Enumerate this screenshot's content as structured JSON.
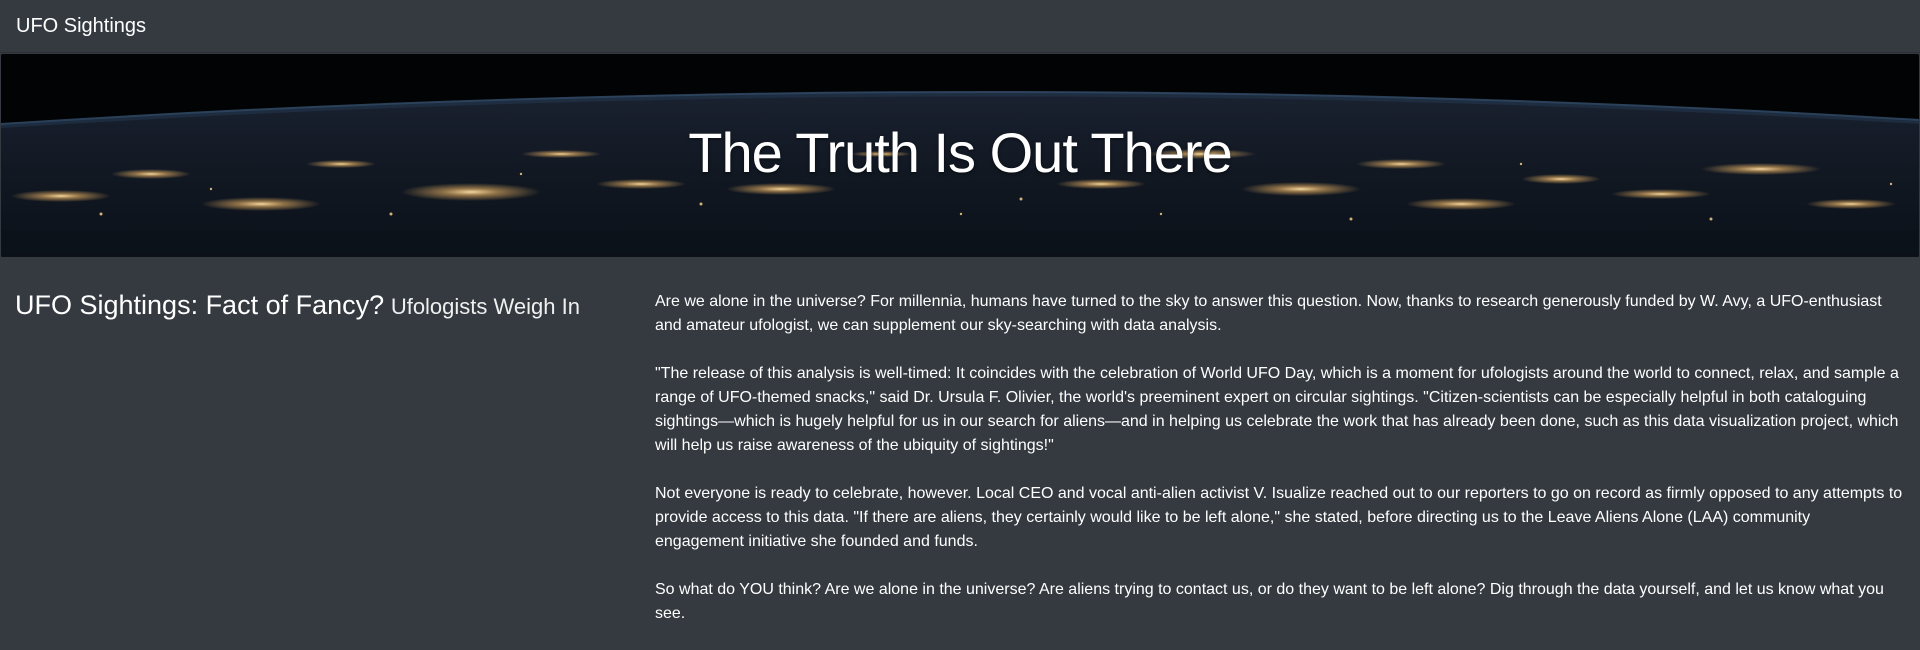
{
  "navbar": {
    "brand": "UFO Sightings"
  },
  "hero": {
    "title": "The Truth Is Out There"
  },
  "headline": {
    "main": "UFO Sightings: Fact of Fancy?",
    "sub": "Ufologists Weigh In"
  },
  "article": {
    "paragraphs": [
      "Are we alone in the universe? For millennia, humans have turned to the sky to answer this question. Now, thanks to research generously funded by W. Avy, a UFO-enthusiast and amateur ufologist, we can supplement our sky-searching with data analysis.",
      "\"The release of this analysis is well-timed: It coincides with the celebration of World UFO Day, which is a moment for ufologists around the world to connect, relax, and sample a range of UFO-themed snacks,\" said Dr. Ursula F. Olivier, the world's preeminent expert on circular sightings. \"Citizen-scientists can be especially helpful in both cataloguing sightings—which is hugely helpful for us in our search for aliens—and in helping us celebrate the work that has already been done, such as this data visualization project, which will help us raise awareness of the ubiquity of sightings!\"",
      "Not everyone is ready to celebrate, however. Local CEO and vocal anti-alien activist V. Isualize reached out to our reporters to go on record as firmly opposed to any attempts to provide access to this data. \"If there are aliens, they certainly would like to be left alone,\" she stated, before directing us to the Leave Aliens Alone (LAA) community engagement initiative she founded and funds.",
      "So what do YOU think? Are we alone in the universe? Are aliens trying to contact us, or do they want to be left alone? Dig through the data yourself, and let us know what you see."
    ]
  }
}
